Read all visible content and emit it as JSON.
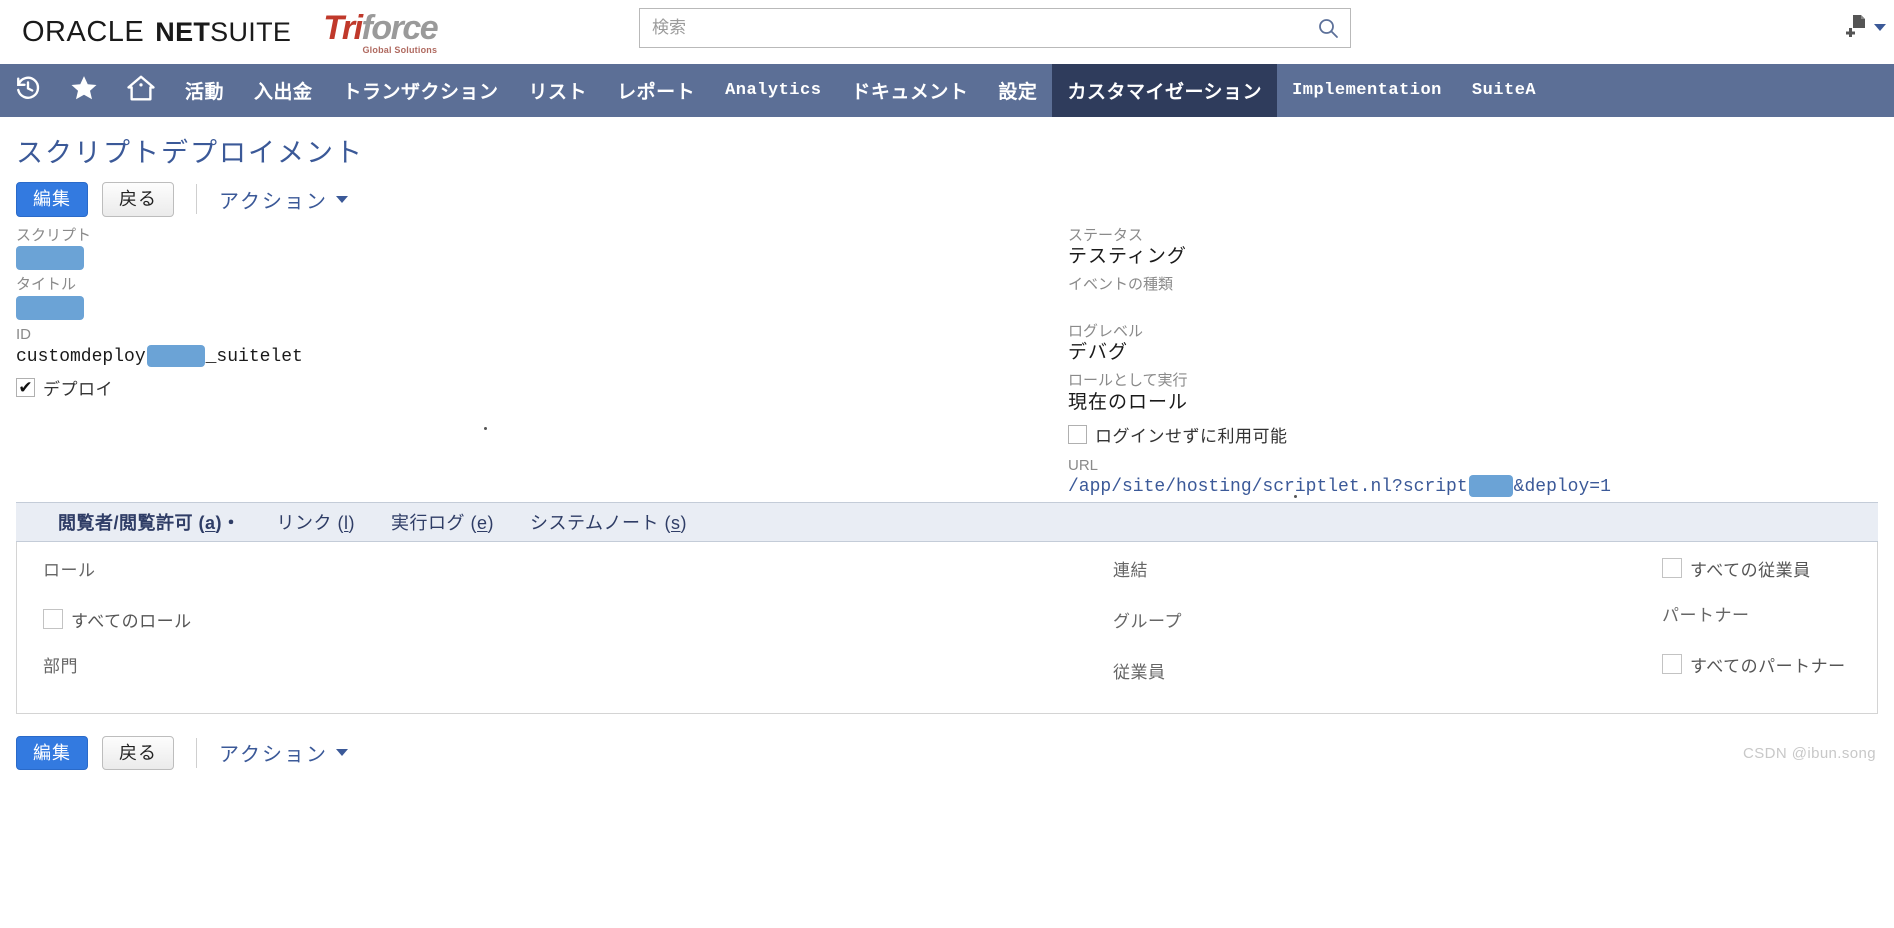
{
  "masthead": {
    "oracle_text": "ORACLE",
    "netsuite_bold": "NET",
    "netsuite_light": "SUITE",
    "partner_logo_tri": "Tri",
    "partner_logo_force": "force",
    "partner_logo_sub": "Global Solutions",
    "search_placeholder": "検索",
    "search_value": "",
    "search_icon": "search-icon",
    "create_new_icon": "create-new-icon",
    "create_new_caret": "▾"
  },
  "navbar": {
    "icons": [
      {
        "name": "recent-history-icon",
        "glyph": "↻"
      },
      {
        "name": "favorites-star-icon",
        "glyph": "★"
      },
      {
        "name": "home-icon",
        "glyph": "⌂"
      }
    ],
    "items": [
      {
        "label": "活動",
        "active": false,
        "latin": false
      },
      {
        "label": "入出金",
        "active": false,
        "latin": false
      },
      {
        "label": "トランザクション",
        "active": false,
        "latin": false
      },
      {
        "label": "リスト",
        "active": false,
        "latin": false
      },
      {
        "label": "レポート",
        "active": false,
        "latin": false
      },
      {
        "label": "Analytics",
        "active": false,
        "latin": true
      },
      {
        "label": "ドキュメント",
        "active": false,
        "latin": false
      },
      {
        "label": "設定",
        "active": false,
        "latin": false
      },
      {
        "label": "カスタマイゼーション",
        "active": true,
        "latin": false
      },
      {
        "label": "Implementation",
        "active": false,
        "latin": true
      },
      {
        "label": "SuiteA",
        "active": false,
        "latin": true
      }
    ]
  },
  "page": {
    "title": "スクリプトデプロイメント",
    "toolbar": {
      "edit_label": "編集",
      "back_label": "戻る",
      "action_label": "アクション"
    },
    "left_fields": {
      "script_label": "スクリプト",
      "script_value": "",
      "title_label": "タイトル",
      "title_value": "",
      "id_label": "ID",
      "id_prefix": "customdeploy",
      "id_suffix": "_suitelet",
      "deploy_checkbox_label": "デプロイ",
      "deploy_checked": true
    },
    "right_fields": {
      "status_label": "ステータス",
      "status_value": "テスティング",
      "event_type_label": "イベントの種類",
      "event_type_value": "",
      "log_level_label": "ログレベル",
      "log_level_value": "デバグ",
      "execute_as_role_label": "ロールとして実行",
      "execute_as_role_value": "現在のロール",
      "available_without_login_label": "ログインせずに利用可能",
      "available_without_login_checked": false,
      "url_label": "URL",
      "url_prefix": "/app/site/hosting/scriptlet.nl?script",
      "url_suffix": "&deploy=1"
    },
    "tabs": [
      {
        "label": "閲覧者/閲覧許可",
        "accel": "a",
        "active": true
      },
      {
        "label": "リンク",
        "accel": "l",
        "active": false
      },
      {
        "label": "実行ログ",
        "accel": "e",
        "active": false
      },
      {
        "label": "システムノート",
        "accel": "s",
        "active": false
      }
    ],
    "tab_panel": {
      "col1": {
        "role_label": "ロール",
        "all_roles_label": "すべてのロール",
        "all_roles_checked": false,
        "department_label": "部門"
      },
      "col2": {
        "consolidate_label": "連結",
        "group_label": "グループ",
        "employee_label": "従業員"
      },
      "col3": {
        "all_employees_label": "すべての従業員",
        "all_employees_checked": false,
        "partner_label": "パートナー",
        "all_partners_label": "すべてのパートナー",
        "all_partners_checked": false
      }
    },
    "bottom_toolbar": {
      "edit_label": "編集",
      "back_label": "戻る",
      "action_label": "アクション"
    }
  },
  "watermark": "CSDN @ibun.song",
  "colors": {
    "nav_bg": "#5c6f96",
    "nav_active_bg": "#2f3c5c",
    "primary_button": "#337ae0",
    "link": "#3b5998",
    "redaction": "#6ba3d6"
  }
}
